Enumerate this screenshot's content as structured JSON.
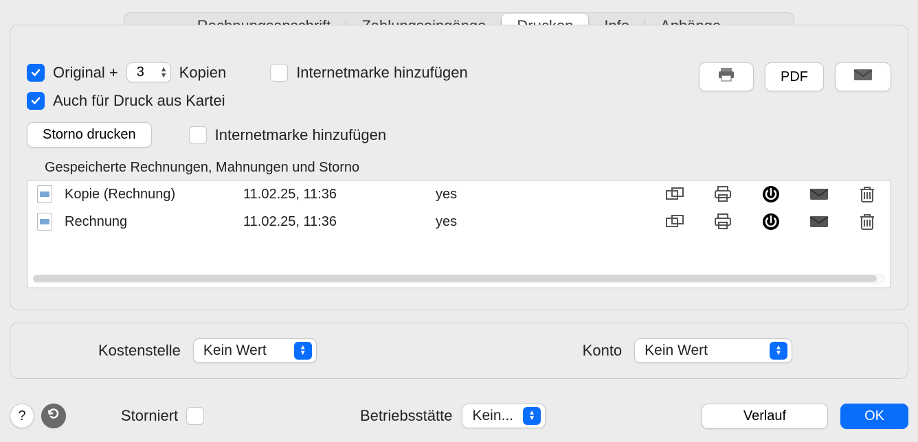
{
  "tabs": {
    "rechnungsanschrift": "Rechnungsanschrift",
    "zahlungseingaenge": "Zahlungseingänge",
    "drucken": "Drucken",
    "info": "Info",
    "anhaenge": "Anhänge"
  },
  "main": {
    "original_label": "Original  +",
    "copies_value": "3",
    "kopien_label": "Kopien",
    "internetmarke_label": "Internetmarke hinzufügen",
    "auch_druck_label": "Auch für Druck aus Kartei",
    "storno_drucken_button": "Storno drucken",
    "internetmarke_label2": "Internetmarke hinzufügen",
    "pdf_button": "PDF",
    "table_label": "Gespeicherte Rechnungen, Mahnungen und Storno"
  },
  "rows": [
    {
      "name": "Kopie (Rechnung)",
      "date": "11.02.25, 11:36",
      "flag": "yes"
    },
    {
      "name": "Rechnung",
      "date": "11.02.25, 11:36",
      "flag": "yes"
    }
  ],
  "panel2": {
    "kostenstelle_label": "Kostenstelle",
    "kostenstelle_value": "Kein Wert",
    "konto_label": "Konto",
    "konto_value": "Kein Wert"
  },
  "bottom": {
    "storniert_label": "Storniert",
    "betriebsstaette_label": "Betriebsstätte",
    "betriebsstaette_value": "Kein...",
    "verlauf_button": "Verlauf",
    "ok_button": "OK",
    "help_label": "?"
  }
}
